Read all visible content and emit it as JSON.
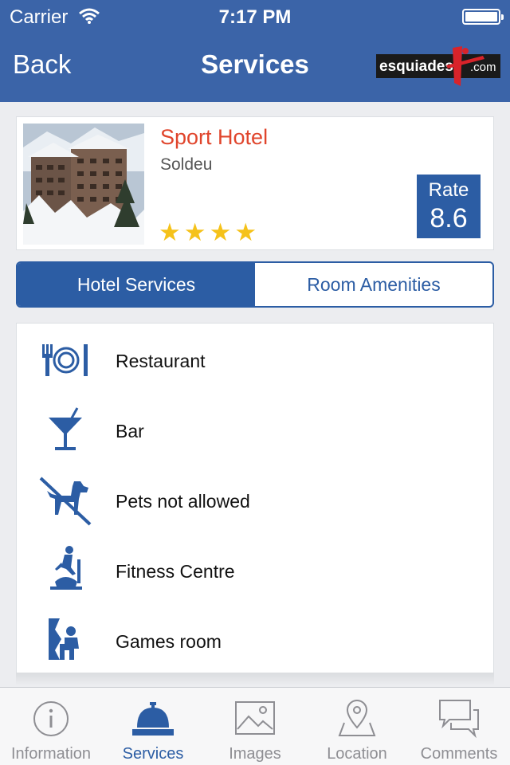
{
  "status_bar": {
    "carrier": "Carrier",
    "time": "7:17 PM"
  },
  "nav": {
    "back_label": "Back",
    "title": "Services",
    "logo_text": "esquiades",
    "logo_suffix": ".com"
  },
  "hotel": {
    "name": "Sport Hotel",
    "location": "Soldeu",
    "stars": 4,
    "rate_label": "Rate",
    "rate_value": "8.6"
  },
  "segments": [
    {
      "label": "Hotel Services",
      "selected": true
    },
    {
      "label": "Room Amenities",
      "selected": false
    }
  ],
  "services": [
    {
      "label": "Restaurant",
      "icon": "restaurant-icon"
    },
    {
      "label": "Bar",
      "icon": "cocktail-icon"
    },
    {
      "label": "Pets not allowed",
      "icon": "no-pets-icon"
    },
    {
      "label": "Fitness Centre",
      "icon": "fitness-icon"
    },
    {
      "label": "Games room",
      "icon": "games-room-icon"
    }
  ],
  "tabs": [
    {
      "label": "Information",
      "icon": "info-icon"
    },
    {
      "label": "Services",
      "icon": "reception-bell-icon",
      "active": true
    },
    {
      "label": "Images",
      "icon": "image-icon"
    },
    {
      "label": "Location",
      "icon": "map-pin-icon"
    },
    {
      "label": "Comments",
      "icon": "chat-bubbles-icon"
    }
  ],
  "colors": {
    "brand": "#3b64a8",
    "accent": "#2c5da4",
    "hotel_name": "#e0452c",
    "star": "#f5c21a"
  }
}
